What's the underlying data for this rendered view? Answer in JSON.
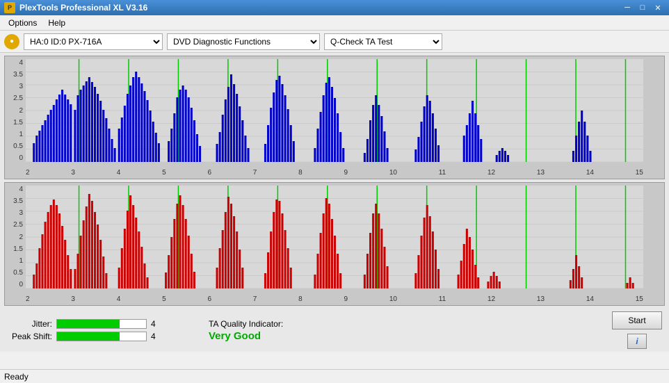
{
  "titlebar": {
    "title": "PlexTools Professional XL V3.16",
    "icon_label": "P",
    "minimize_label": "─",
    "maximize_label": "□",
    "close_label": "✕"
  },
  "menubar": {
    "items": [
      "Options",
      "Help"
    ]
  },
  "toolbar": {
    "drive_label": "HA:0 ID:0  PX-716A",
    "function_label": "DVD Diagnostic Functions",
    "test_label": "Q-Check TA Test"
  },
  "charts": {
    "top": {
      "color": "blue",
      "y_labels": [
        "4",
        "3.5",
        "3",
        "2.5",
        "2",
        "1.5",
        "1",
        "0.5",
        "0"
      ],
      "x_labels": [
        "2",
        "3",
        "4",
        "5",
        "6",
        "7",
        "8",
        "9",
        "10",
        "11",
        "12",
        "13",
        "14",
        "15"
      ]
    },
    "bottom": {
      "color": "red",
      "y_labels": [
        "4",
        "3.5",
        "3",
        "2.5",
        "2",
        "1.5",
        "1",
        "0.5",
        "0"
      ],
      "x_labels": [
        "2",
        "3",
        "4",
        "5",
        "6",
        "7",
        "8",
        "9",
        "10",
        "11",
        "12",
        "13",
        "14",
        "15"
      ]
    }
  },
  "metrics": {
    "jitter_label": "Jitter:",
    "jitter_value": "4",
    "peak_shift_label": "Peak Shift:",
    "peak_shift_value": "4",
    "quality_title": "TA Quality Indicator:",
    "quality_value": "Very Good"
  },
  "buttons": {
    "start_label": "Start",
    "info_label": "i"
  },
  "statusbar": {
    "status": "Ready"
  }
}
